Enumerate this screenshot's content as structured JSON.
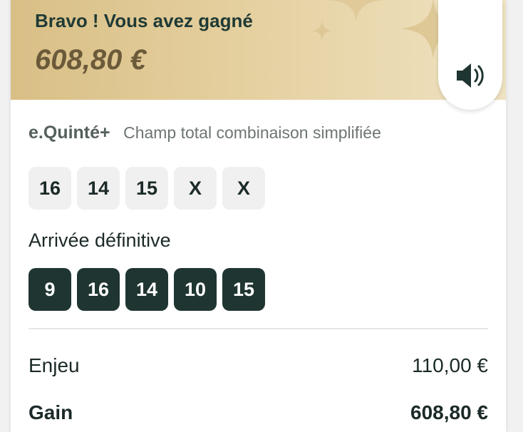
{
  "banner": {
    "title": "Bravo ! Vous avez gagné",
    "amount": "608,80 €"
  },
  "sound_icon": "speaker-icon",
  "bet": {
    "type": "e.Quinté+",
    "description": "Champ total combinaison simplifiée",
    "selection": [
      "16",
      "14",
      "15",
      "X",
      "X"
    ]
  },
  "arrival": {
    "label": "Arrivée définitive",
    "numbers": [
      "9",
      "16",
      "14",
      "10",
      "15"
    ]
  },
  "summary": {
    "stake_label": "Enjeu",
    "stake_value": "110,00 €",
    "gain_label": "Gain",
    "gain_value": "608,80 €"
  },
  "colors": {
    "dark_chip": "#1f3532",
    "light_chip": "#f0f0f0",
    "banner_gold": "#d9bf86",
    "amount_text": "#6b5a3a"
  }
}
